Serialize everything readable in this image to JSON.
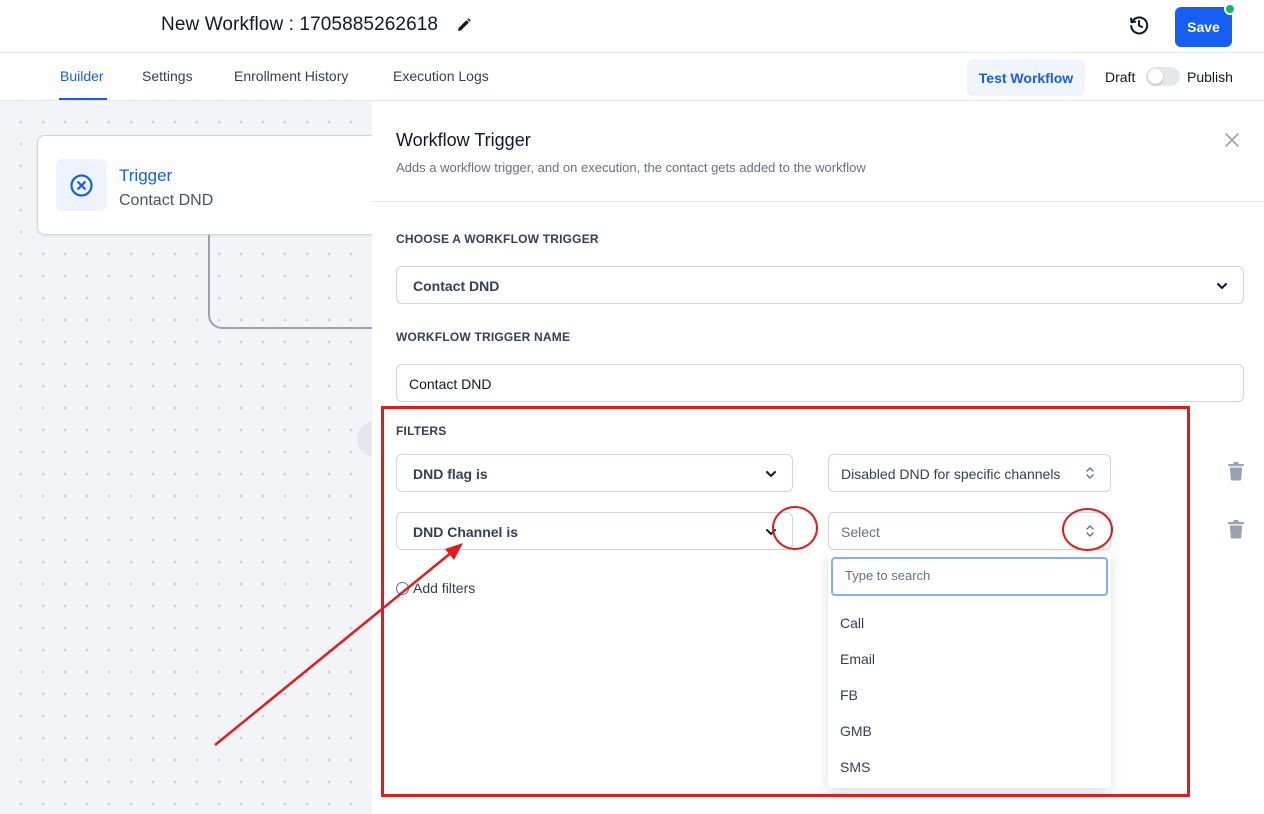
{
  "header": {
    "workflow_title": "New Workflow : 1705885262618",
    "save_label": "Save"
  },
  "tabs": [
    {
      "label": "Builder",
      "active": true
    },
    {
      "label": "Settings",
      "active": false
    },
    {
      "label": "Enrollment History",
      "active": false
    },
    {
      "label": "Execution Logs",
      "active": false
    }
  ],
  "toolbar": {
    "test_workflow_label": "Test Workflow",
    "draft_label": "Draft",
    "publish_label": "Publish",
    "published": false
  },
  "canvas": {
    "trigger_card": {
      "title": "Trigger",
      "subtitle": "Contact DND"
    }
  },
  "panel": {
    "title": "Workflow Trigger",
    "subtitle": "Adds a workflow trigger, and on execution, the contact gets added to the workflow",
    "choose_trigger_label": "CHOOSE A WORKFLOW TRIGGER",
    "trigger_value": "Contact DND",
    "trigger_name_label": "WORKFLOW TRIGGER NAME",
    "trigger_name_value": "Contact DND",
    "filters_label": "FILTERS",
    "filters": [
      {
        "field": "DND flag is",
        "value": "Disabled DND for specific channels"
      },
      {
        "field": "DND Channel is",
        "value": "",
        "placeholder": "Select"
      }
    ],
    "add_filters_label": "Add filters",
    "dropdown": {
      "search_placeholder": "Type to search",
      "options": [
        "Call",
        "Email",
        "FB",
        "GMB",
        "SMS"
      ]
    }
  },
  "colors": {
    "accent": "#155eef",
    "annotation": "#e41b1b",
    "status_dot": "#12b76a"
  }
}
